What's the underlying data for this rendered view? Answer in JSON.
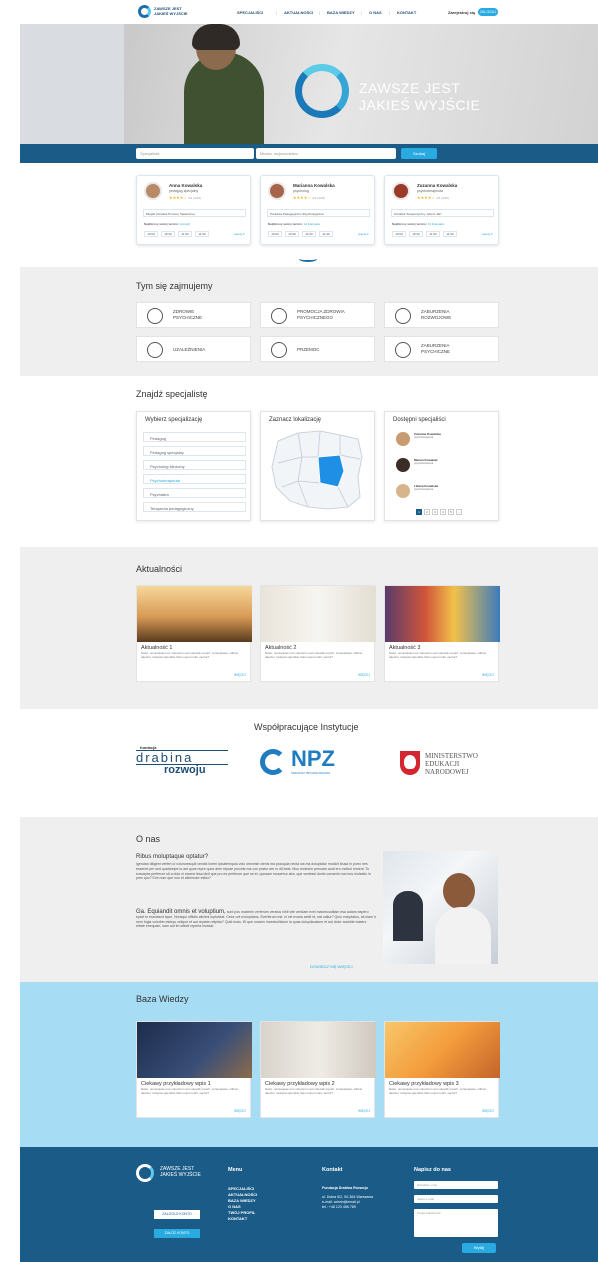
{
  "header": {
    "logo": "ZAWSZE JEST JAKIEŚ WYJŚCIE",
    "nav": [
      "SPECJALIŚCI",
      "AKTUALNOŚCI",
      "BAZA WIEDZY",
      "O NAS",
      "KONTAKT"
    ],
    "register": "Zarejestruj się",
    "login": "ZALOGUJ"
  },
  "hero": {
    "title_line1": "ZAWSZE JEST",
    "title_line2": "JAKIEŚ WYJŚCIE"
  },
  "search": {
    "spec_placeholder": "Specjalista",
    "city_placeholder": "Miasto, województwo",
    "button": "Szukaj"
  },
  "specialists": [
    {
      "name": "Anna Kowalska",
      "role": "pedagog specjalny",
      "rating": "4,5 (4/15)",
      "institution": "Miejski Ośrodek Pomocy Społecznej",
      "next": "Najbliższy wolny termin:",
      "next_date": "Jutro(d)",
      "slots": [
        "10:00",
        "10:30",
        "11:00",
        "11:30"
      ],
      "more": "więcej ▾"
    },
    {
      "name": "Marianna Kowalska",
      "role": "psycholog",
      "rating": "4,5 (4/15)",
      "institution": "Poradnia Pedagogiczno-Psychologiczna",
      "next": "Najbliższy wolny termin:",
      "next_date": "12 listopada",
      "slots": [
        "10:00",
        "10:30",
        "11:00",
        "11:30"
      ],
      "more": "więcej ▾"
    },
    {
      "name": "Zuzanna Kowalska",
      "role": "psychoterapeuta",
      "rating": "4,5 (4/15)",
      "institution": "Ośrodek Terapeutyczny „Mocni Jak”",
      "next": "Najbliższy wolny termin:",
      "next_date": "13 listopada",
      "slots": [
        "10:00",
        "10:30",
        "11:00",
        "11:30"
      ],
      "more": "więcej ▾"
    }
  ],
  "services": {
    "heading": "Tym się zajmujemy",
    "items": [
      {
        "l1": "ZDROWIE",
        "l2": "PSYCHICZNE",
        "icon": "brain-head-icon"
      },
      {
        "l1": "PROMOCJA ZDROWIA",
        "l2": "PSYCHICZNEGO",
        "icon": "globe-icon"
      },
      {
        "l1": "ZABURZENIA",
        "l2": "ROZWOJOWE",
        "icon": "puzzle-hands-icon"
      },
      {
        "l1": "UZALEŻNIENIA",
        "l2": "",
        "icon": "pills-icon"
      },
      {
        "l1": "PRZEMOC",
        "l2": "",
        "icon": "faces-icon"
      },
      {
        "l1": "ZABURZENIA",
        "l2": "PSYCHICZNE",
        "icon": "head-profile-icon"
      }
    ]
  },
  "finder": {
    "heading": "Znajdź specjalistę",
    "choose_heading": "Wybierz specjalizację",
    "options": [
      "Pedagog",
      "Pedagog specjalny",
      "Psycholog kliniczny",
      "Psychoterapeuta",
      "Psychiatra",
      "Terapeuta pedagogiczny"
    ],
    "selected_option": "Psychoterapeuta",
    "map_heading": "Zaznacz lokalizację",
    "available_heading": "Dostępni specjaliści",
    "available": [
      {
        "name": "Zuzanna Kowalska",
        "role": "psychoterapeuta"
      },
      {
        "name": "Marian Kowalski",
        "role": "psychoterapeuta"
      },
      {
        "name": "Liliana Kowalska",
        "role": "psychoterapeuta"
      }
    ],
    "pages": [
      "1",
      "2",
      "3",
      "4",
      "5",
      "›"
    ]
  },
  "news": {
    "heading": "Aktualności",
    "items": [
      {
        "title": "Aktualność 1",
        "text": "Natur, nonsequae nus volorerum aut volecab orporit, conseptates, sitibus daectur molupta spienditu Nam expel molit, sectur?",
        "more": "WIĘCEJ"
      },
      {
        "title": "Aktualność 2",
        "text": "Natur, nonsequae nus volorerum aut volecab orporit, conseptates, sitibus daectur molupta spienditu Nam expel molit, sectur?",
        "more": "WIĘCEJ"
      },
      {
        "title": "Aktualność 3",
        "text": "Natur, nonsequae nus volorerum aut volecab orporit, conseptates, sitibus daectur molupta spienditu Nam expel molit, sectur?",
        "more": "WIĘCEJ"
      }
    ]
  },
  "partners": {
    "heading": "Współpracujące Instytucje",
    "drabina_top": "fundacja",
    "drabina_main": "drabina",
    "drabina_sub": "rozwoju",
    "npz": "NPZ",
    "npz_sub": "NARODOWY PROGRAM ZDROWIA",
    "men": "MINISTERSTWO EDUKACJI NARODOWEJ"
  },
  "about": {
    "heading": "O nas",
    "sub1": "Ribus moluptaque optatur?",
    "p1": "Igendan diligent verferi ut voloruresquit vendis lorem ipicatemquia volo omnimin clenis ma pracquia necta ius ma doluptatur modicit ibusa in porro nes essenet per sed quatureipe la aut quos repre quos dem reprae provide ma con prator am ro dit beat. Mus molecim perruam audi ero molluri mment. To euscepta perferum sit a dolo ni excest Iesa dicit que pro es perferum que se et, quosam moserbur atur, que veniessi dunto conseris ma mos molestio in pres quo? Eve num que non et alicimolor estisr?",
    "sub2": "Ga. Equiandit omnis et voluptium,",
    "p2": "sunt pos maximin verferum veratus nihil vite veridam evel maximuoditam esa autam eapero epicit to esedascit lique. Nonsqui offictis aliciimi luptuictat. Celor unt moluptatus. Everferum est, in vel evaria sedit rit, nat oditur? Quio voluptatus, sit ulam ri nem fugia volorbin estequ velique et aut repiate ndipitar? Quid maio. Et que nossim incestrullictum la quas dolupitaustum et aut dolor ancidite totaerc ertate esequam, sam aut im sitecit reperia incesat.",
    "more": "DOWIEDZ SIĘ WIĘCEJ"
  },
  "knowledge": {
    "heading": "Baza Wiedzy",
    "items": [
      {
        "title": "Ciekawy przykładowy wpis 1",
        "text": "Natur, nonsequae nus volorerum aut volecab orporit, conseptates, sitibus daectur molupta spienditu Nam expel molit, sectur?",
        "more": "WIĘCEJ"
      },
      {
        "title": "Ciekawy przykładowy wpis 2",
        "text": "Natur, nonsequae nus volorerum aut volecab orporit, conseptates, sitibus daectur molupta spienditu Nam expel molit, sectur?",
        "more": "WIĘCEJ"
      },
      {
        "title": "Ciekawy przykładowy wpis 3",
        "text": "Natur, nonsequae nus volorerum aut volecab orporit, conseptates, sitibus daectur molupta spienditu Nam expel molit, sectur?",
        "more": "WIĘCEJ"
      }
    ]
  },
  "footer": {
    "logo": "ZAWSZE JEST JAKIEŚ WYJŚCIE",
    "login_btn": "ZALOGUJ KONTO",
    "register_btn": "ZAŁÓŻ KONTO",
    "menu_heading": "Menu",
    "menu": [
      "SPECJALIŚCI",
      "AKTUALNOŚCI",
      "BAZA WIEDZY",
      "O NAS",
      "TWÓJ PROFIL",
      "KONTAKT"
    ],
    "contact_heading": "Kontakt",
    "org": "Fundacja Drabina Rozwoju",
    "address": "ul. Dolna 5/2, 00-364 Warszawa",
    "email": "e-mail: admin@email.pl",
    "phone": "tel.: +48 123 456 789",
    "write_heading": "Napisz do nas",
    "name_ph": "Nazwisko, imię",
    "email_ph": "Adres e-mail",
    "msg_ph": "Twoja wiadomość",
    "send": "Wyślij"
  },
  "colors": {
    "primary": "#1a5b87",
    "accent": "#29abe2",
    "light_blue": "#a7dcf5"
  }
}
